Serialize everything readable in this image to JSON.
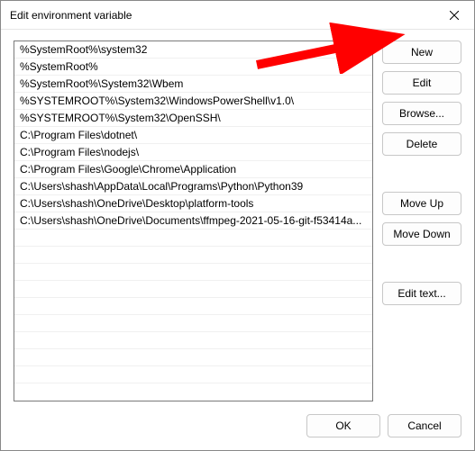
{
  "window": {
    "title": "Edit environment variable"
  },
  "list": {
    "items": [
      "%SystemRoot%\\system32",
      "%SystemRoot%",
      "%SystemRoot%\\System32\\Wbem",
      "%SYSTEMROOT%\\System32\\WindowsPowerShell\\v1.0\\",
      "%SYSTEMROOT%\\System32\\OpenSSH\\",
      "C:\\Program Files\\dotnet\\",
      "C:\\Program Files\\nodejs\\",
      "C:\\Program Files\\Google\\Chrome\\Application",
      "C:\\Users\\shash\\AppData\\Local\\Programs\\Python\\Python39",
      "C:\\Users\\shash\\OneDrive\\Desktop\\platform-tools",
      "C:\\Users\\shash\\OneDrive\\Documents\\ffmpeg-2021-05-16-git-f53414a..."
    ]
  },
  "buttons": {
    "new": "New",
    "edit": "Edit",
    "browse": "Browse...",
    "delete": "Delete",
    "move_up": "Move Up",
    "move_down": "Move Down",
    "edit_text": "Edit text...",
    "ok": "OK",
    "cancel": "Cancel"
  },
  "annotation": {
    "arrow_color": "#ff0000"
  }
}
